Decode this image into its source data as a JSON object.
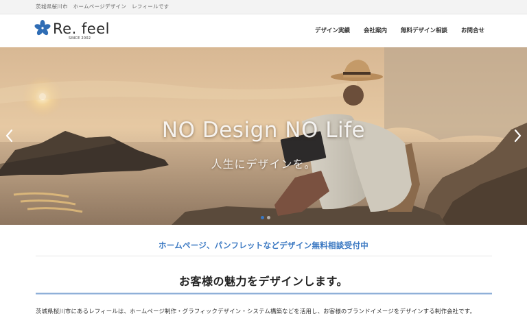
{
  "topbar": {
    "text": "茨城県桜川市　ホームページデザイン　レフィールです"
  },
  "logo": {
    "name": "Re. feel",
    "since": "SINCE 2002",
    "mark_color": "#2f6db5"
  },
  "nav": {
    "items": [
      {
        "label": "デザイン実績"
      },
      {
        "label": "会社案内"
      },
      {
        "label": "無料デザイン相談"
      },
      {
        "label": "お問合せ"
      }
    ]
  },
  "hero": {
    "title": "NO Design NO Life",
    "subtitle": "人生にデザインを。",
    "prev_icon": "chevron-left-icon",
    "next_icon": "chevron-right-icon",
    "slide_count": 2,
    "active_slide": 1
  },
  "banner": {
    "text": "ホームページ、パンフレットなどデザイン無料相談受付中"
  },
  "main": {
    "headline": "お客様の魅力をデザインします。",
    "body": "茨城県桜川市にあるレフィールは、ホームページ制作・グラフィックデザイン・システム構築などを活用し、お客様のブランドイメージをデザインする制作会社です。"
  },
  "colors": {
    "accent": "#3a78c2",
    "rule": "#8fb0d8"
  }
}
